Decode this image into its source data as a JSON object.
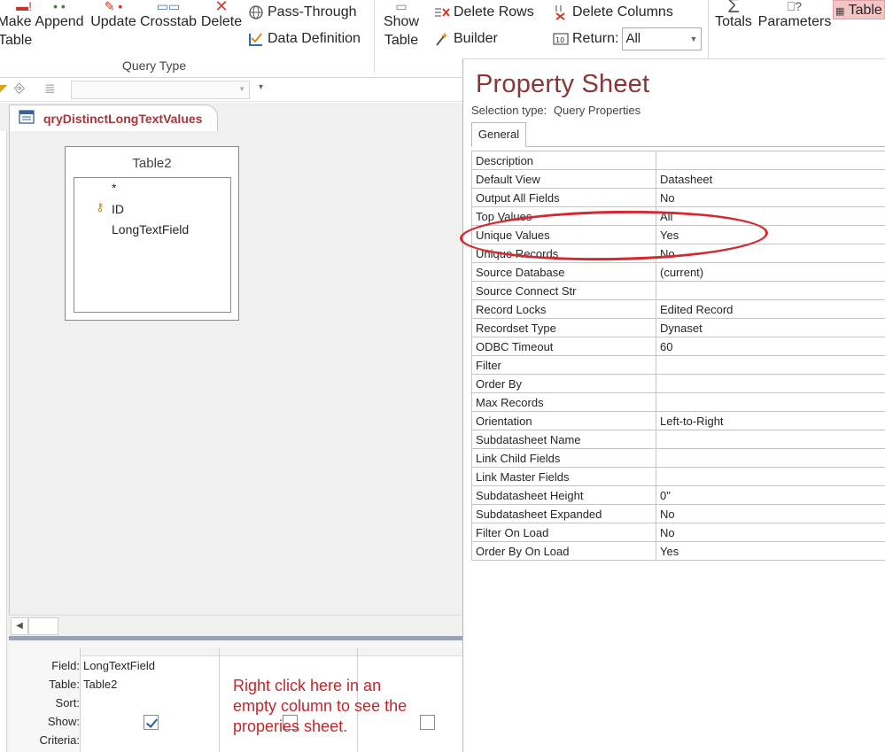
{
  "ribbon": {
    "make_table_label_1": "Make",
    "make_table_label_2": "Table",
    "append_label": "Append",
    "update_label": "Update",
    "crosstab_label": "Crosstab",
    "delete_label": "Delete",
    "pass_through_label": "Pass-Through",
    "data_definition_label": "Data Definition",
    "query_type_group": "Query Type",
    "show_table_label_1": "Show",
    "show_table_label_2": "Table",
    "delete_rows_label": "Delete Rows",
    "builder_label": "Builder",
    "delete_columns_label": "Delete Columns",
    "return_label": "Return:",
    "return_value": "All",
    "totals_label": "Totals",
    "parameters_label": "Parameters",
    "table_names_label": "Table"
  },
  "document": {
    "tab_title": "qryDistinctLongTextValues",
    "field_list": {
      "title": "Table2",
      "items": [
        "*",
        "ID",
        "LongTextField"
      ]
    }
  },
  "grid": {
    "row_labels": [
      "Field:",
      "Table:",
      "Sort:",
      "Show:",
      "Criteria:"
    ],
    "columns": [
      {
        "field": "LongTextField",
        "table": "Table2",
        "sort": "",
        "show": true,
        "criteria": ""
      },
      {
        "field": "",
        "table": "",
        "sort": "",
        "show": false,
        "criteria": ""
      },
      {
        "field": "",
        "table": "",
        "sort": "",
        "show": false,
        "criteria": ""
      }
    ],
    "annotation": "Right click here in an empty column to see the properies sheet."
  },
  "property_sheet": {
    "title": "Property Sheet",
    "selection_type_label": "Selection type:",
    "selection_type_value": "Query Properties",
    "tab_general": "General",
    "properties": [
      {
        "name": "Description",
        "value": ""
      },
      {
        "name": "Default View",
        "value": "Datasheet"
      },
      {
        "name": "Output All Fields",
        "value": "No"
      },
      {
        "name": "Top Values",
        "value": "All"
      },
      {
        "name": "Unique Values",
        "value": "Yes"
      },
      {
        "name": "Unique Records",
        "value": "No"
      },
      {
        "name": "Source Database",
        "value": "(current)"
      },
      {
        "name": "Source Connect Str",
        "value": ""
      },
      {
        "name": "Record Locks",
        "value": "Edited Record"
      },
      {
        "name": "Recordset Type",
        "value": "Dynaset"
      },
      {
        "name": "ODBC Timeout",
        "value": "60"
      },
      {
        "name": "Filter",
        "value": ""
      },
      {
        "name": "Order By",
        "value": ""
      },
      {
        "name": "Max Records",
        "value": ""
      },
      {
        "name": "Orientation",
        "value": "Left-to-Right"
      },
      {
        "name": "Subdatasheet Name",
        "value": ""
      },
      {
        "name": "Link Child Fields",
        "value": ""
      },
      {
        "name": "Link Master Fields",
        "value": ""
      },
      {
        "name": "Subdatasheet Height",
        "value": "0\""
      },
      {
        "name": "Subdatasheet Expanded",
        "value": "No"
      },
      {
        "name": "Filter On Load",
        "value": "No"
      },
      {
        "name": "Order By On Load",
        "value": "Yes"
      }
    ]
  },
  "colors": {
    "accent": "#a4373a",
    "annotation": "#c4272b",
    "highlight_ring": "#d22a30"
  }
}
